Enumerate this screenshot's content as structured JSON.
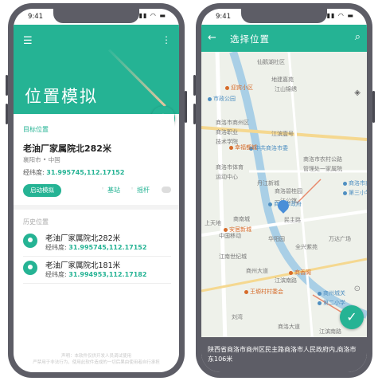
{
  "left": {
    "status": {
      "time": "9:41",
      "indicators": "▮▮ ◠ ▬"
    },
    "header": {
      "menu_icon": "menu-icon",
      "more_icon": "more-vert-icon",
      "title": "位置模拟",
      "fab_label": "+"
    },
    "target": {
      "label": "目标位置",
      "address": "老油厂家属院北282米",
      "city": "襄阳市 • 中国",
      "coord_label": "经纬度:",
      "coord_value": "31.995745,112.17152",
      "start_button": "启动模拟",
      "option_basestation": "基站",
      "option_joystick": "摇杆"
    },
    "history": {
      "label": "历史位置",
      "items": [
        {
          "title": "老油厂家属院北282米",
          "coord_label": "经纬度:",
          "coord_value": "31.995745,112.17152"
        },
        {
          "title": "老油厂家属院北181米",
          "coord_label": "经纬度:",
          "coord_value": "31.994953,112.17182"
        }
      ]
    },
    "footer": {
      "line1": "声明：本软件仅供开发人员调试使用",
      "line2": "严禁用于非法行为，使用此软件造成的一切后果由使用者自行承担"
    }
  },
  "right": {
    "status": {
      "time": "9:41",
      "indicators": "▮▮ ◠ ▬"
    },
    "header": {
      "back_icon": "arrow-back-icon",
      "title": "选择位置",
      "search_icon": "search-icon"
    },
    "map_labels": [
      {
        "text": "仙鹅湖社区",
        "cls": "g"
      },
      {
        "text": "地建嘉苑",
        "cls": "g"
      },
      {
        "text": "江山锦绣",
        "cls": "g"
      },
      {
        "text": "市政公园",
        "cls": "b"
      },
      {
        "text": "迎宾小区",
        "cls": "o"
      },
      {
        "text": "商洛市商州区",
        "cls": "g"
      },
      {
        "text": "商洛职业",
        "cls": "g"
      },
      {
        "text": "技术学院",
        "cls": "g"
      },
      {
        "text": "江滨壹号",
        "cls": "g"
      },
      {
        "text": "中共商洛市委",
        "cls": "b"
      },
      {
        "text": "幸福都城",
        "cls": "o"
      },
      {
        "text": "商洛市农村公路",
        "cls": "g"
      },
      {
        "text": "管理处一家属院",
        "cls": "g"
      },
      {
        "text": "商洛市体育",
        "cls": "g"
      },
      {
        "text": "运动中心",
        "cls": "g"
      },
      {
        "text": "丹江新城",
        "cls": "g"
      },
      {
        "text": "商洛碧桂园",
        "cls": "g"
      },
      {
        "text": "一江公馆",
        "cls": "g"
      },
      {
        "text": "商洛市商州区",
        "cls": "b"
      },
      {
        "text": "第三小学",
        "cls": "b"
      },
      {
        "text": "商洛市政府",
        "cls": "b"
      },
      {
        "text": "民主路",
        "cls": "g"
      },
      {
        "text": "上天地",
        "cls": "g"
      },
      {
        "text": "商南城",
        "cls": "g"
      },
      {
        "text": "中国移动",
        "cls": "g"
      },
      {
        "text": "安居新城",
        "cls": "o"
      },
      {
        "text": "华阳园",
        "cls": "g"
      },
      {
        "text": "全兴紫苑",
        "cls": "g"
      },
      {
        "text": "万达广场",
        "cls": "g"
      },
      {
        "text": "江南世纪城",
        "cls": "g"
      },
      {
        "text": "商州大道",
        "cls": "g"
      },
      {
        "text": "江滨南路",
        "cls": "g"
      },
      {
        "text": "商香阁",
        "cls": "o"
      },
      {
        "text": "商州城关",
        "cls": "b"
      },
      {
        "text": "第二小学",
        "cls": "b"
      },
      {
        "text": "王塬村村委会",
        "cls": "o"
      },
      {
        "text": "刘湾",
        "cls": "g"
      },
      {
        "text": "商洛大道",
        "cls": "g"
      },
      {
        "text": "江滨南路",
        "cls": "g"
      }
    ],
    "confirm_icon": "check-icon",
    "address": "陕西省商洛市商州区民主路商洛市人民政府内,商洛市东106米"
  }
}
